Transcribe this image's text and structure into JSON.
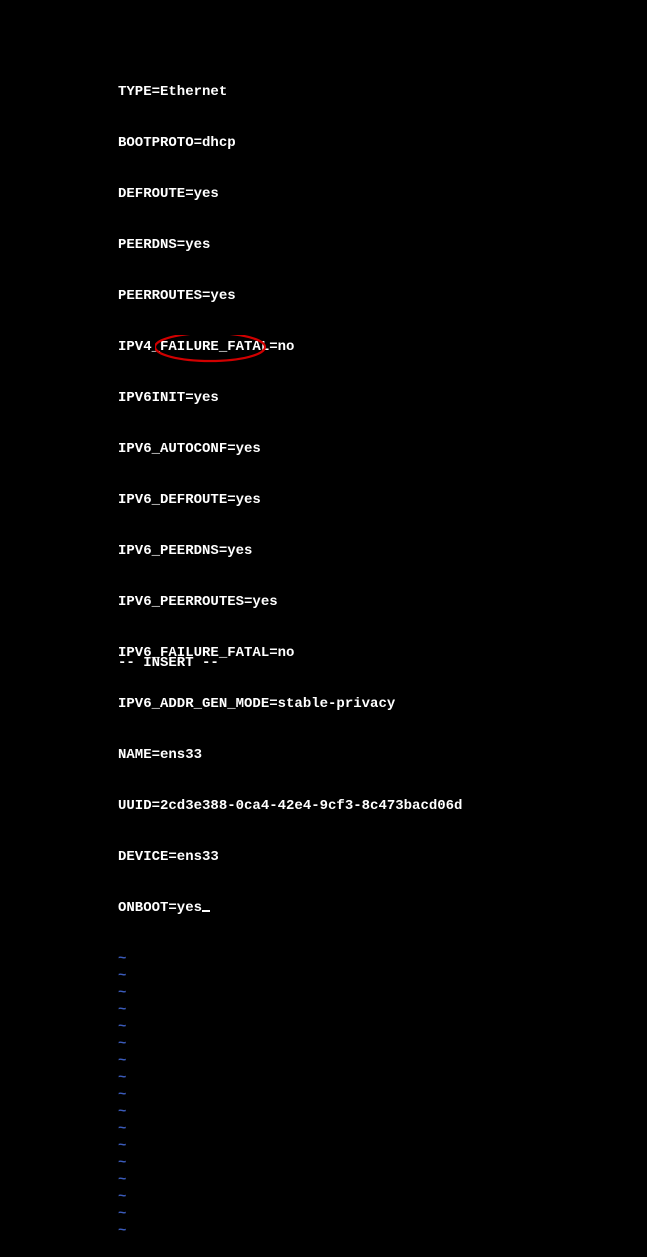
{
  "config_lines": {
    "l0": "TYPE=Ethernet",
    "l1": "BOOTPROTO=dhcp",
    "l2": "DEFROUTE=yes",
    "l3": "PEERDNS=yes",
    "l4": "PEERROUTES=yes",
    "l5": "IPV4_FAILURE_FATAL=no",
    "l6": "IPV6INIT=yes",
    "l7": "IPV6_AUTOCONF=yes",
    "l8": "IPV6_DEFROUTE=yes",
    "l9": "IPV6_PEERDNS=yes",
    "l10": "IPV6_PEERROUTES=yes",
    "l11": "IPV6_FAILURE_FATAL=no",
    "l12": "IPV6_ADDR_GEN_MODE=stable-privacy",
    "l13": "NAME=ens33",
    "l14": "UUID=2cd3e388-0ca4-42e4-9cf3-8c473bacd06d",
    "l15": "DEVICE=ens33",
    "l16": "ONBOOT=yes"
  },
  "tilde": "~",
  "empty_line_count": 17,
  "status_line": "-- INSERT --",
  "annotation": {
    "color": "#d10000"
  }
}
